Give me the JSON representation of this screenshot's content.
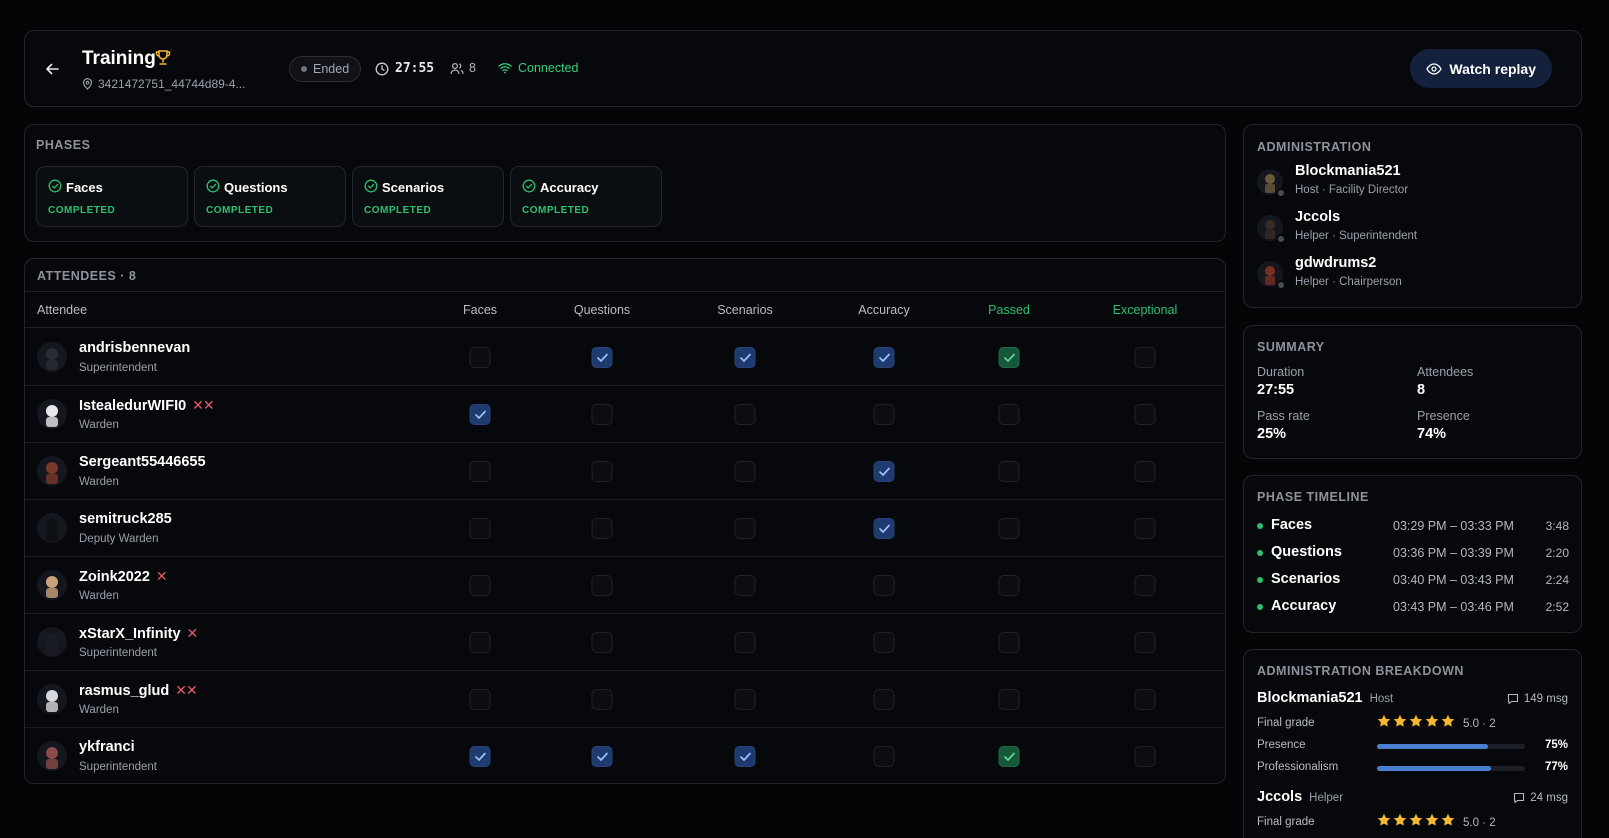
{
  "header": {
    "title": "Training",
    "session_id": "3421472751_44744d89-4...",
    "status": "Ended",
    "timer": "27:55",
    "user_count": "8",
    "connection": "Connected",
    "replay_label": "Watch replay"
  },
  "phases": {
    "title": "PHASES",
    "items": [
      {
        "name": "Faces",
        "status": "COMPLETED"
      },
      {
        "name": "Questions",
        "status": "COMPLETED"
      },
      {
        "name": "Scenarios",
        "status": "COMPLETED"
      },
      {
        "name": "Accuracy",
        "status": "COMPLETED"
      }
    ]
  },
  "attendees": {
    "title": "ATTENDEES · 8",
    "columns": [
      "Attendee",
      "Faces",
      "Questions",
      "Scenarios",
      "Accuracy",
      "Passed",
      "Exceptional"
    ],
    "rows": [
      {
        "name": "andrisbennevan",
        "role": "Superintendent",
        "marks": "",
        "faces": false,
        "questions": true,
        "scenarios": true,
        "accuracy": true,
        "passed": true,
        "exceptional": false
      },
      {
        "name": "IstealedurWIFI0",
        "role": "Warden",
        "marks": "✕✕",
        "faces": true,
        "questions": false,
        "scenarios": false,
        "accuracy": false,
        "passed": false,
        "exceptional": false
      },
      {
        "name": "Sergeant55446655",
        "role": "Warden",
        "marks": "",
        "faces": false,
        "questions": false,
        "scenarios": false,
        "accuracy": true,
        "passed": false,
        "exceptional": false
      },
      {
        "name": "semitruck285",
        "role": "Deputy Warden",
        "marks": "",
        "faces": false,
        "questions": false,
        "scenarios": false,
        "accuracy": true,
        "passed": false,
        "exceptional": false
      },
      {
        "name": "Zoink2022",
        "role": "Warden",
        "marks": "✕",
        "faces": false,
        "questions": false,
        "scenarios": false,
        "accuracy": false,
        "passed": false,
        "exceptional": false
      },
      {
        "name": "xStarX_Infinity",
        "role": "Superintendent",
        "marks": "✕",
        "faces": false,
        "questions": false,
        "scenarios": false,
        "accuracy": false,
        "passed": false,
        "exceptional": false
      },
      {
        "name": "rasmus_glud",
        "role": "Warden",
        "marks": "✕✕",
        "faces": false,
        "questions": false,
        "scenarios": false,
        "accuracy": false,
        "passed": false,
        "exceptional": false
      },
      {
        "name": "ykfranci",
        "role": "Superintendent",
        "marks": "",
        "faces": true,
        "questions": true,
        "scenarios": true,
        "accuracy": false,
        "passed": true,
        "exceptional": false
      }
    ]
  },
  "administration": {
    "title": "ADMINISTRATION",
    "staff": [
      {
        "name": "Blockmania521",
        "role": "Host · Facility Director"
      },
      {
        "name": "Jccols",
        "role": "Helper · Superintendent"
      },
      {
        "name": "gdwdrums2",
        "role": "Helper · Chairperson"
      }
    ]
  },
  "summary": {
    "title": "SUMMARY",
    "duration_label": "Duration",
    "duration": "27:55",
    "attendees_label": "Attendees",
    "attendees": "8",
    "passrate_label": "Pass rate",
    "passrate": "25%",
    "presence_label": "Presence",
    "presence": "74%"
  },
  "timeline": {
    "title": "PHASE TIMELINE",
    "items": [
      {
        "name": "Faces",
        "range": "03:29 PM – 03:33 PM",
        "duration": "3:48"
      },
      {
        "name": "Questions",
        "range": "03:36 PM – 03:39 PM",
        "duration": "2:20"
      },
      {
        "name": "Scenarios",
        "range": "03:40 PM – 03:43 PM",
        "duration": "2:24"
      },
      {
        "name": "Accuracy",
        "range": "03:43 PM – 03:46 PM",
        "duration": "2:52"
      }
    ]
  },
  "breakdown": {
    "title": "ADMINISTRATION BREAKDOWN",
    "staff": [
      {
        "name": "Blockmania521",
        "role": "Host",
        "messages": "149 msg",
        "grade_label": "Final grade",
        "grade": "5.0 · 2",
        "stars": 5,
        "presence_label": "Presence",
        "presence": "75%",
        "presence_value": 0.75,
        "prof_label": "Professionalism",
        "prof": "77%",
        "prof_value": 0.77
      },
      {
        "name": "Jccols",
        "role": "Helper",
        "messages": "24 msg",
        "grade_label": "Final grade",
        "grade": "5.0 · 2",
        "stars": 5
      }
    ]
  },
  "colors": {
    "accent_green": "#2fbf6f",
    "check_blue": "#1e3a6e",
    "star": "#f5b82e",
    "danger": "#e45a66"
  }
}
